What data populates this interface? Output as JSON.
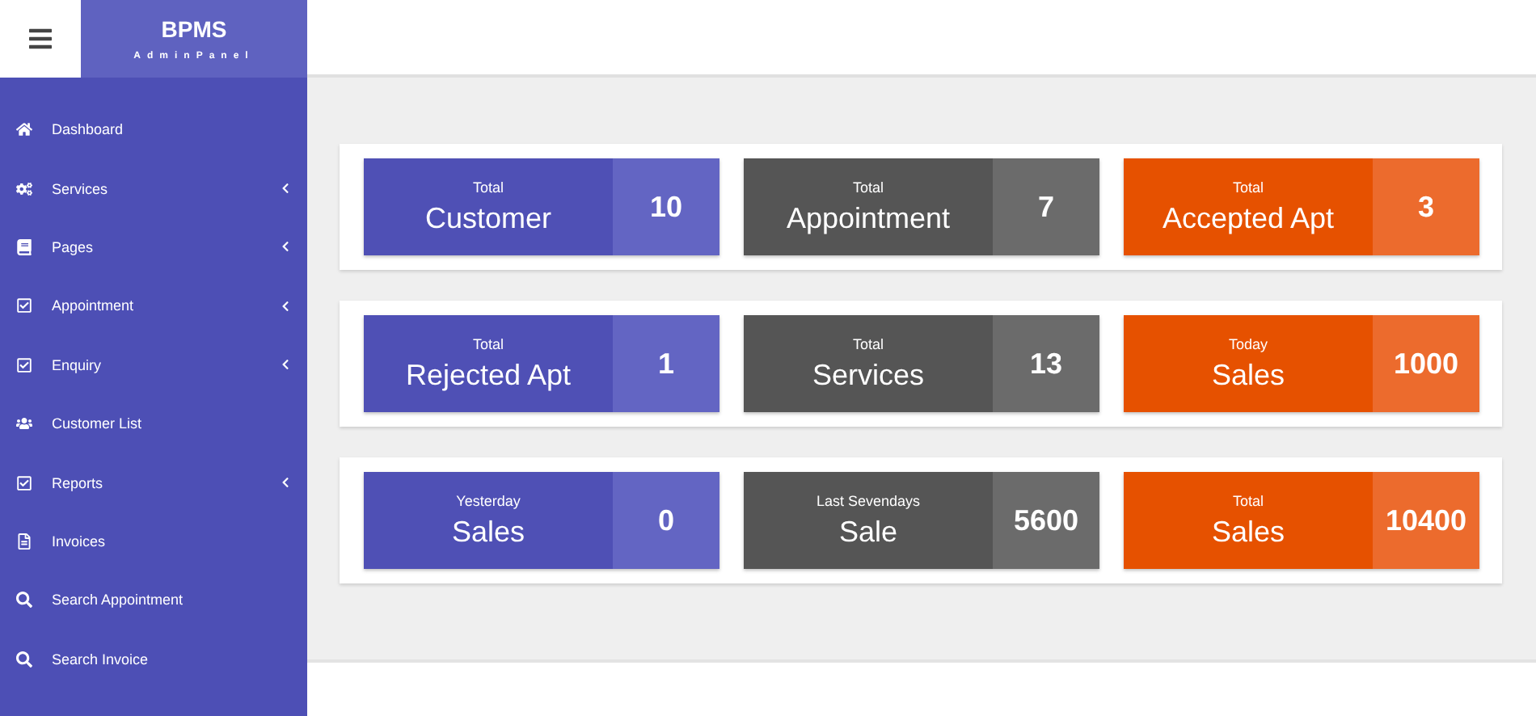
{
  "brand": {
    "title": "BPMS",
    "subtitle": "AdminPanel"
  },
  "sidebar": {
    "items": [
      {
        "label": "Dashboard",
        "expandable": false
      },
      {
        "label": "Services",
        "expandable": true
      },
      {
        "label": "Pages",
        "expandable": true
      },
      {
        "label": "Appointment",
        "expandable": true
      },
      {
        "label": "Enquiry",
        "expandable": true
      },
      {
        "label": "Customer List",
        "expandable": false
      },
      {
        "label": "Reports",
        "expandable": true
      },
      {
        "label": "Invoices",
        "expandable": false
      },
      {
        "label": "Search Appointment",
        "expandable": false
      },
      {
        "label": "Search Invoice",
        "expandable": false
      }
    ]
  },
  "stat_rows": [
    [
      {
        "kind": "purple",
        "caption": "Total",
        "title": "Customer",
        "value": "10"
      },
      {
        "kind": "grey",
        "caption": "Total",
        "title": "Appointment",
        "value": "7"
      },
      {
        "kind": "orange",
        "caption": "Total",
        "title": "Accepted Apt",
        "value": "3"
      }
    ],
    [
      {
        "kind": "purple",
        "caption": "Total",
        "title": "Rejected Apt",
        "value": "1"
      },
      {
        "kind": "grey",
        "caption": "Total",
        "title": "Services",
        "value": "13"
      },
      {
        "kind": "orange",
        "caption": "Today",
        "title": "Sales",
        "value": "1000"
      }
    ],
    [
      {
        "kind": "purple",
        "caption": "Yesterday",
        "title": "Sales",
        "value": "0"
      },
      {
        "kind": "grey",
        "caption": "Last Sevendays",
        "title": "Sale",
        "value": "5600"
      },
      {
        "kind": "orange",
        "caption": "Total",
        "title": "Sales",
        "value": "10400"
      }
    ]
  ]
}
